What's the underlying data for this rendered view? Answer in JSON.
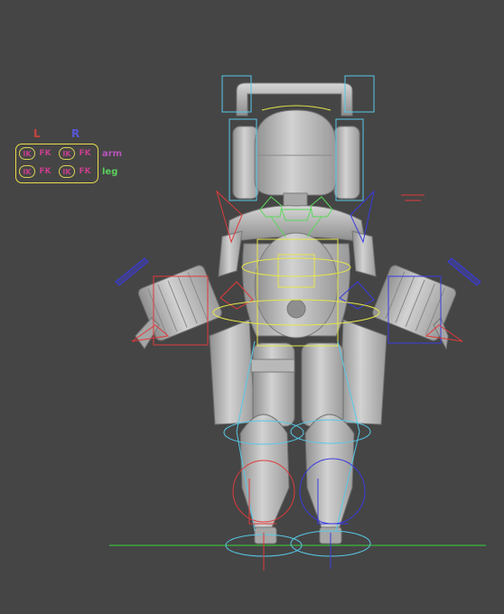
{
  "viewport": {
    "background": "#454545"
  },
  "switcher": {
    "side_left": "L",
    "side_right": "R",
    "arm_label": "arm",
    "leg_label": "leg",
    "ik": "IK",
    "fk": "FK",
    "frame_color": "#e9dc4a"
  },
  "colors": {
    "model": "#c8c8c8",
    "ground": "#39d439",
    "left_ctrl": "#e03a3a",
    "right_ctrl": "#3a3ae0",
    "center_ctrl": "#58c8e6",
    "cog_ctrl": "#e6e64a",
    "face_ctrl": "#5ad85a"
  }
}
